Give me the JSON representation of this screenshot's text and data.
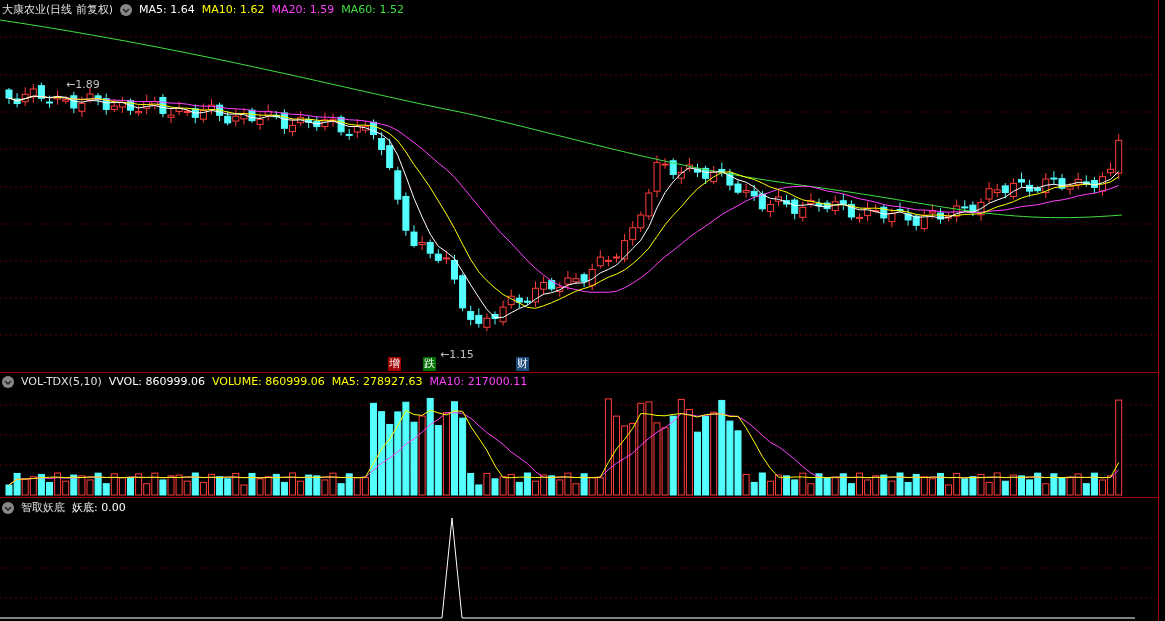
{
  "main_panel": {
    "title": "大康农业(日线 前复权)",
    "indicators": [
      {
        "label": "MA5: 1.64",
        "color": "#ffffff"
      },
      {
        "label": "MA10: 1.62",
        "color": "#ffff00"
      },
      {
        "label": "MA20: 1.59",
        "color": "#ff40ff"
      },
      {
        "label": "MA60: 1.52",
        "color": "#40e040"
      }
    ],
    "high_marker": "←1.89",
    "low_marker": "←1.15",
    "signals": [
      {
        "text": "增",
        "color": "#a00000"
      },
      {
        "text": "跌",
        "color": "#007000"
      },
      {
        "text": "财",
        "color": "#1c4a7c"
      }
    ]
  },
  "volume_panel": {
    "indicator": "VOL-TDX(5,10)",
    "readings": [
      {
        "label": "VVOL: 860999.06",
        "color": "#ffffff"
      },
      {
        "label": "VOLUME: 860999.06",
        "color": "#ffff00"
      },
      {
        "label": "MA5: 278927.63",
        "color": "#ffff00"
      },
      {
        "label": "MA10: 217000.11",
        "color": "#ff40ff"
      }
    ]
  },
  "indicator_panel": {
    "name": "智取妖底",
    "readings": [
      {
        "label": "妖底: 0.00",
        "color": "#ffffff"
      }
    ]
  }
}
